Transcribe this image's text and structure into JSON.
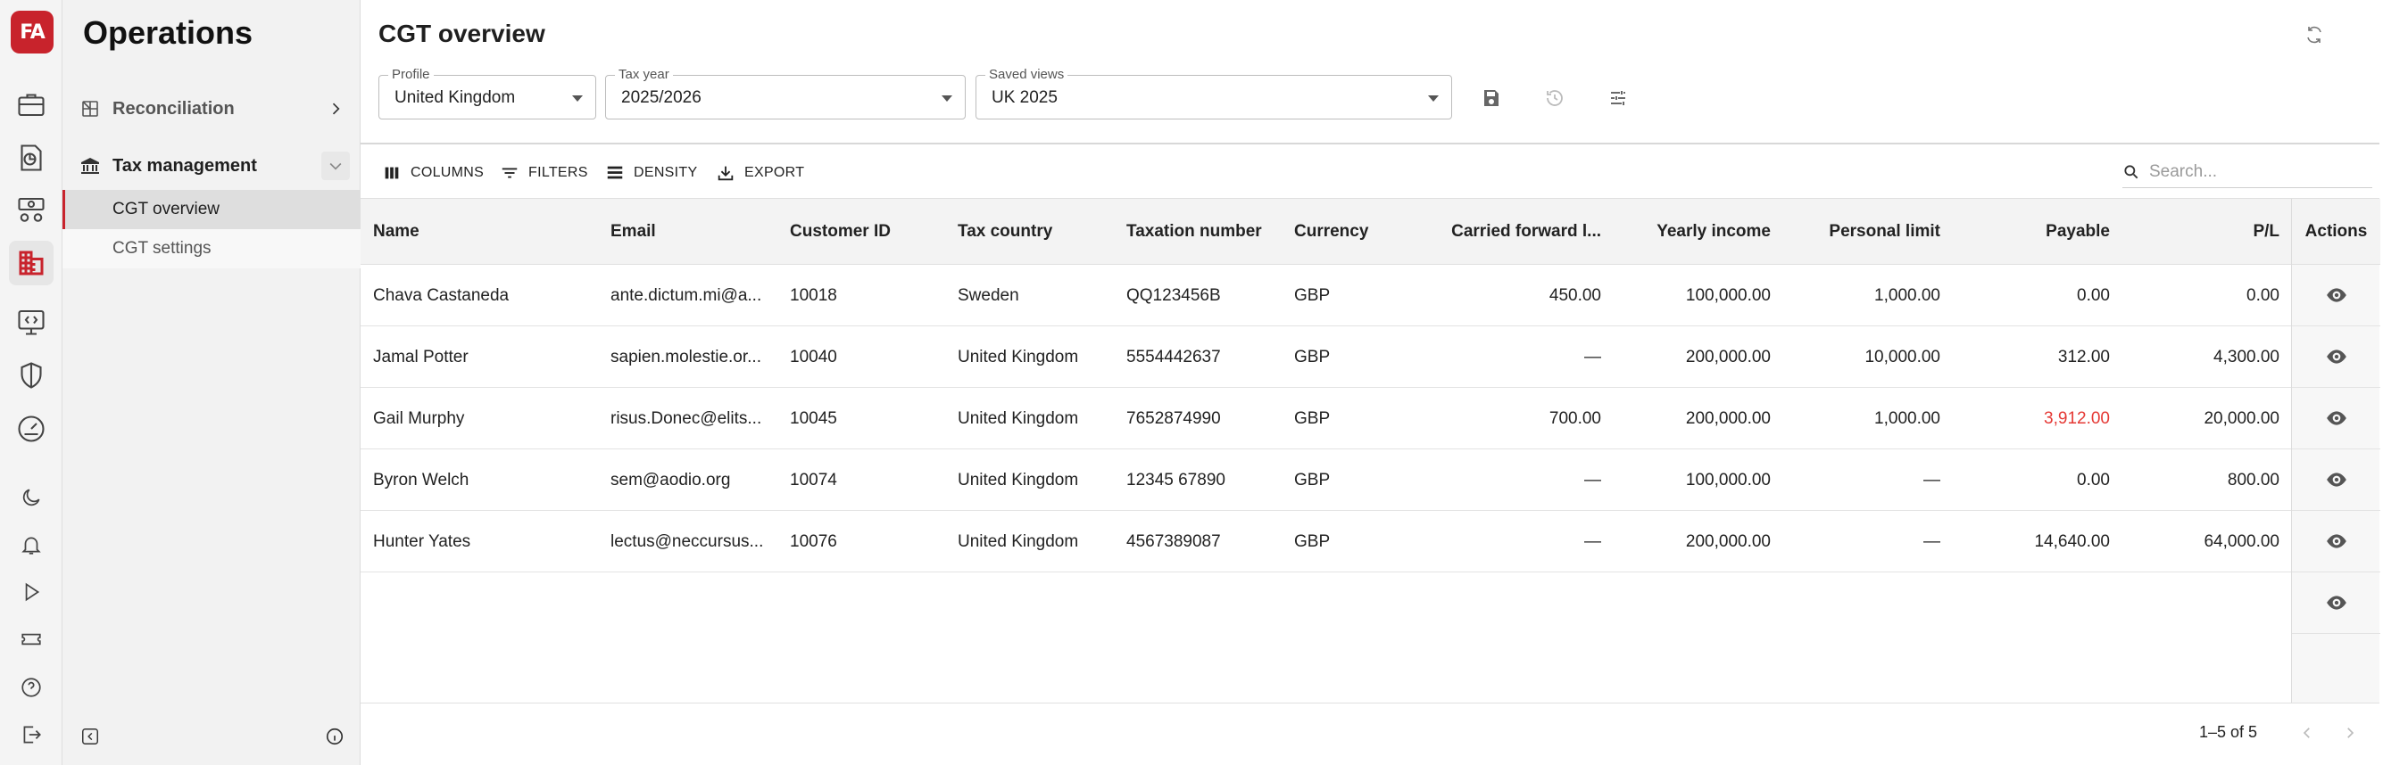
{
  "app": {
    "logo_text": "FA",
    "brand_color": "#c8232c"
  },
  "rail": {
    "icons": [
      "briefcase-icon",
      "pie-chart-report-icon",
      "money-exchange-icon",
      "building-icon",
      "code-window-icon",
      "shield-icon",
      "gauge-icon",
      "moon-icon",
      "bell-icon",
      "play-icon",
      "ticket-icon",
      "help-icon",
      "logout-icon"
    ],
    "active": "building-icon"
  },
  "sidebar": {
    "title": "Operations",
    "items": [
      {
        "label": "Reconciliation",
        "icon": "reconciliation-icon",
        "expanded": false
      },
      {
        "label": "Tax management",
        "icon": "bank-icon",
        "expanded": true,
        "children": [
          {
            "label": "CGT overview",
            "active": true
          },
          {
            "label": "CGT settings",
            "active": false
          }
        ]
      }
    ]
  },
  "page": {
    "title": "CGT overview"
  },
  "filters": {
    "profile": {
      "label": "Profile",
      "value": "United Kingdom"
    },
    "tax_year": {
      "label": "Tax year",
      "value": "2025/2026"
    },
    "saved_views": {
      "label": "Saved views",
      "value": "UK 2025"
    }
  },
  "toolbar": {
    "columns": "COLUMNS",
    "filters": "FILTERS",
    "density": "DENSITY",
    "export": "EXPORT",
    "search_placeholder": "Search..."
  },
  "table": {
    "columns": [
      "Name",
      "Email",
      "Customer ID",
      "Tax country",
      "Taxation number",
      "Currency",
      "Carried forward l...",
      "Yearly income",
      "Personal limit",
      "Payable",
      "P/L"
    ],
    "actions_header": "Actions",
    "rows": [
      {
        "name": "Chava Castaneda",
        "email": "ante.dictum.mi@a...",
        "customer_id": "10018",
        "tax_country": "Sweden",
        "taxation_number": "QQ123456B",
        "currency": "GBP",
        "carried_forward": "450.00",
        "yearly_income": "100,000.00",
        "personal_limit": "1,000.00",
        "payable": "0.00",
        "pl": "0.00"
      },
      {
        "name": "Jamal Potter",
        "email": "sapien.molestie.or...",
        "customer_id": "10040",
        "tax_country": "United Kingdom",
        "taxation_number": "5554442637",
        "currency": "GBP",
        "carried_forward": "—",
        "yearly_income": "200,000.00",
        "personal_limit": "10,000.00",
        "payable": "312.00",
        "pl": "4,300.00"
      },
      {
        "name": "Gail Murphy",
        "email": "risus.Donec@elits...",
        "customer_id": "10045",
        "tax_country": "United Kingdom",
        "taxation_number": "7652874990",
        "currency": "GBP",
        "carried_forward": "700.00",
        "yearly_income": "200,000.00",
        "personal_limit": "1,000.00",
        "payable": "3,912.00",
        "pl": "20,000.00"
      },
      {
        "name": "Byron Welch",
        "email": "sem@aodio.org",
        "customer_id": "10074",
        "tax_country": "United Kingdom",
        "taxation_number": "12345 67890",
        "currency": "GBP",
        "carried_forward": "—",
        "yearly_income": "100,000.00",
        "personal_limit": "—",
        "payable": "0.00",
        "pl": "800.00"
      },
      {
        "name": "Hunter Yates",
        "email": "lectus@neccursus...",
        "customer_id": "10076",
        "tax_country": "United Kingdom",
        "taxation_number": "4567389087",
        "currency": "GBP",
        "carried_forward": "—",
        "yearly_income": "200,000.00",
        "personal_limit": "—",
        "payable": "14,640.00",
        "pl": "64,000.00"
      }
    ],
    "highlight_color": "#e53935"
  },
  "pagination": {
    "text": "1–5 of 5"
  }
}
